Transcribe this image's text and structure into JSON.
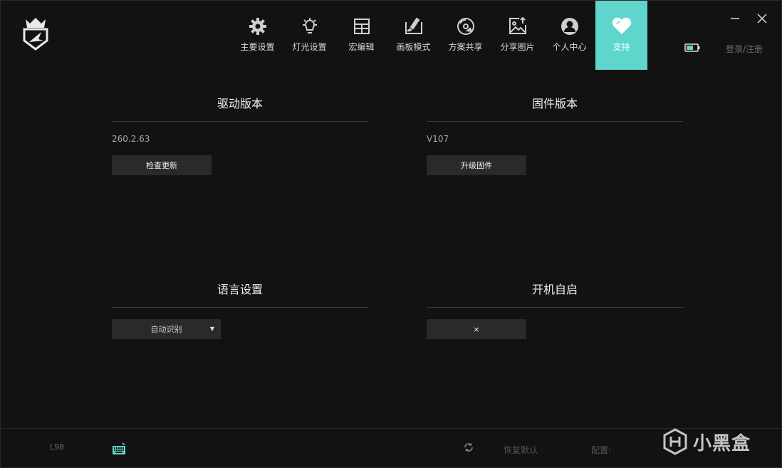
{
  "nav": {
    "items": [
      {
        "label": "主要设置",
        "icon": "gear-icon"
      },
      {
        "label": "灯光设置",
        "icon": "lightbulb-icon"
      },
      {
        "label": "宏编辑",
        "icon": "grid-table-icon"
      },
      {
        "label": "画板模式",
        "icon": "paint-board-icon"
      },
      {
        "label": "方案共享",
        "icon": "share-disc-icon"
      },
      {
        "label": "分享图片",
        "icon": "image-upload-icon"
      },
      {
        "label": "个人中心",
        "icon": "user-icon"
      },
      {
        "label": "支持",
        "icon": "heart-icon",
        "active": true
      }
    ]
  },
  "header": {
    "login_label": "登录/注册"
  },
  "driver": {
    "title": "驱动版本",
    "version": "260.2.63",
    "button": "检查更新"
  },
  "firmware": {
    "title": "固件版本",
    "version": "V107",
    "button": "升级固件"
  },
  "language": {
    "title": "语言设置",
    "selected": "自动识别"
  },
  "autostart": {
    "title": "开机自启",
    "value": "×"
  },
  "footer": {
    "model": "L98",
    "restore_label": "恢复默认",
    "config_label": "配置:",
    "watermark": "小黑盒"
  },
  "colors": {
    "accent": "#5fd6cc",
    "background": "#121212",
    "button": "#2a2a2a"
  }
}
